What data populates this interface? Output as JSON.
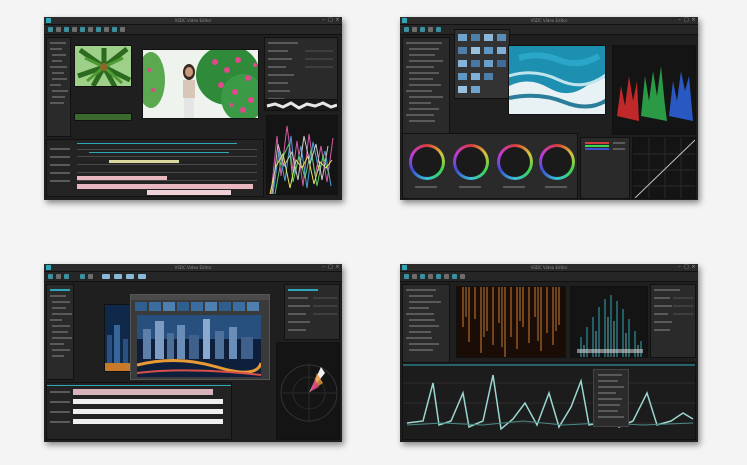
{
  "screenshots": [
    {
      "window_title": "VSDC Video Editor",
      "view": "timeline-editing"
    },
    {
      "window_title": "VSDC Video Editor",
      "view": "color-correction"
    },
    {
      "window_title": "VSDC Video Editor",
      "view": "waveform-scopes"
    },
    {
      "window_title": "VSDC Video Editor",
      "view": "audio-spectrum"
    }
  ],
  "window_controls": {
    "minimize": "–",
    "maximize": "□",
    "close": "×"
  },
  "colors": {
    "page_background": "#f4f4f4",
    "app_background": "#1f1f1f",
    "accent": "#2fa7b8",
    "timeline_clip": "#e8b7c0",
    "wheel_colors": [
      "#c64bd1",
      "#2f6bd8",
      "#2fbf70",
      "#d85d3c"
    ]
  },
  "icons": [
    "app-logo-icon",
    "minimize-icon",
    "maximize-icon",
    "close-icon"
  ]
}
